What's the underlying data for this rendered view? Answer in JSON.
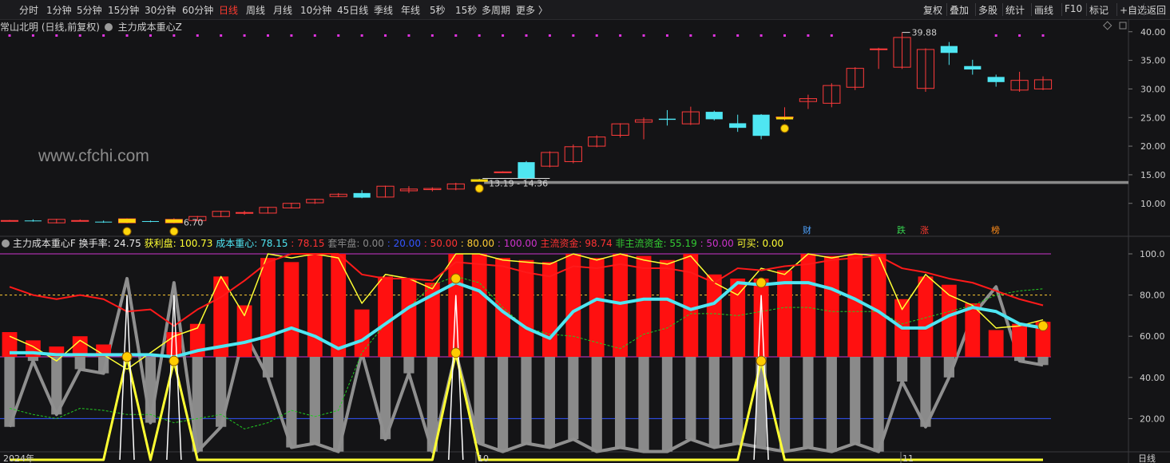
{
  "toolbar": {
    "timeframes": [
      "分时",
      "1分钟",
      "5分钟",
      "15分钟",
      "30分钟",
      "60分钟",
      "日线",
      "周线",
      "月线",
      "10分钟",
      "45日线",
      "季线",
      "年线",
      "5秒",
      "15秒",
      "多周期",
      "更多 〉"
    ],
    "active_timeframe": "日线",
    "right_buttons": [
      "复权",
      "叠加",
      "多股",
      "统计",
      "画线",
      "F10",
      "标记",
      "+自选",
      "返回"
    ]
  },
  "title": {
    "stock": "常山北明 (日线,前复权)",
    "indicator": "主力成本重心Z"
  },
  "price_axis": {
    "labels": [
      "40.00",
      "35.00",
      "30.00",
      "25.00",
      "20.00",
      "15.00",
      "10.00"
    ],
    "min": 5.5,
    "max": 41.5
  },
  "price_annotations": {
    "high": "39.88",
    "low": "6.70",
    "range": "13.19 - 14.36"
  },
  "watermark": "www.cfchi.com",
  "event_markers": [
    {
      "label": "财",
      "color": "#4fa3ff"
    },
    {
      "label": "跌",
      "color": "#36d24f"
    },
    {
      "label": "涨",
      "color": "#ff3b30"
    },
    {
      "label": "榜",
      "color": "#ff8c1a"
    }
  ],
  "indicator": {
    "name": "主力成本重心F",
    "items": [
      {
        "label": "换手率: ",
        "value": "24.75",
        "color": "#e6e6e6"
      },
      {
        "label": "获利盘: ",
        "value": "100.73",
        "color": "#ffff33"
      },
      {
        "label": "成本重心: ",
        "value": "78.15",
        "color": "#4fe6f2"
      },
      {
        "label": ": ",
        "value": "78.15",
        "color": "#ff3333"
      },
      {
        "label": "套牢盘: ",
        "value": "0.00",
        "color": "#888888"
      },
      {
        "label": ": ",
        "value": "20.00",
        "color": "#3355ff"
      },
      {
        "label": ": ",
        "value": "50.00",
        "color": "#ff3333"
      },
      {
        "label": ": ",
        "value": "80.00",
        "color": "#ffcc33"
      },
      {
        "label": ": ",
        "value": "100.00",
        "color": "#cc33cc"
      },
      {
        "label": "主流资金: ",
        "value": "98.74",
        "color": "#ff3333"
      },
      {
        "label": "非主流资金: ",
        "value": "55.19",
        "color": "#33cc33"
      },
      {
        "label": ": ",
        "value": "50.00",
        "color": "#cc33cc"
      },
      {
        "label": "可买: ",
        "value": "0.00",
        "color": "#ffff33"
      }
    ],
    "axis_labels": [
      "100.0",
      "80.00",
      "60.00",
      "40.00",
      "20.00"
    ],
    "min": 0,
    "max": 100
  },
  "date_axis": {
    "labels": [
      "2024年",
      "10",
      "11"
    ],
    "period": "日线"
  },
  "chart_data": {
    "type": "candlestick",
    "candles": [
      [
        6.9,
        7.0,
        6.8,
        7.1
      ],
      [
        7.0,
        6.9,
        6.8,
        7.2
      ],
      [
        6.6,
        7.2,
        6.5,
        7.3
      ],
      [
        7.0,
        7.0,
        6.9,
        7.2
      ],
      [
        6.8,
        6.7,
        6.6,
        7.0
      ],
      [
        6.6,
        7.3,
        6.5,
        7.4
      ],
      [
        6.9,
        6.8,
        6.7,
        7.0
      ],
      [
        6.6,
        7.2,
        6.5,
        7.4
      ],
      [
        7.0,
        7.7,
        6.9,
        7.8
      ],
      [
        7.7,
        8.6,
        7.6,
        8.7
      ],
      [
        8.3,
        8.4,
        8.0,
        8.7
      ],
      [
        8.3,
        9.3,
        8.2,
        9.4
      ],
      [
        9.2,
        10.0,
        9.1,
        10.1
      ],
      [
        10.1,
        10.7,
        9.9,
        10.8
      ],
      [
        11.2,
        11.6,
        11.1,
        11.8
      ],
      [
        11.8,
        11.0,
        10.9,
        12.3
      ],
      [
        11.1,
        13.0,
        11.0,
        13.1
      ],
      [
        12.2,
        12.5,
        11.8,
        13.0
      ],
      [
        12.4,
        12.6,
        12.1,
        12.8
      ],
      [
        12.5,
        13.4,
        12.3,
        13.6
      ],
      [
        14.2,
        14.1,
        14.0,
        14.3
      ],
      [
        15.5,
        15.5,
        15.4,
        15.6
      ],
      [
        17.2,
        14.4,
        14.2,
        17.4
      ],
      [
        16.5,
        18.9,
        16.3,
        19.1
      ],
      [
        17.3,
        19.9,
        17.0,
        20.3
      ],
      [
        20.0,
        21.6,
        19.8,
        21.9
      ],
      [
        21.9,
        23.9,
        21.5,
        24.0
      ],
      [
        24.2,
        24.6,
        21.2,
        25.0
      ],
      [
        24.8,
        24.6,
        23.6,
        26.3
      ],
      [
        23.9,
        26.0,
        23.7,
        26.9
      ],
      [
        26.0,
        24.7,
        24.5,
        26.2
      ],
      [
        24.0,
        23.2,
        22.5,
        25.5
      ],
      [
        25.5,
        21.8,
        21.2,
        25.6
      ],
      [
        25.0,
        25.1,
        24.5,
        26.8
      ],
      [
        27.8,
        28.3,
        26.5,
        29.0
      ],
      [
        27.5,
        30.6,
        26.8,
        31.0
      ],
      [
        30.3,
        33.6,
        29.8,
        33.8
      ],
      [
        37.0,
        37.0,
        33.5,
        37.2
      ],
      [
        33.8,
        39.0,
        33.5,
        39.88
      ],
      [
        30.1,
        36.9,
        29.5,
        37.1
      ],
      [
        37.5,
        36.3,
        34.2,
        38.2
      ],
      [
        34.0,
        33.4,
        32.5,
        35.1
      ],
      [
        32.1,
        31.2,
        30.4,
        32.5
      ],
      [
        29.8,
        31.5,
        29.5,
        33.0
      ],
      [
        30.0,
        31.6,
        29.8,
        32.2
      ]
    ],
    "indicator_series": {
      "turnover": [
        62,
        58,
        55,
        60,
        56,
        51,
        49,
        62,
        66,
        89,
        75,
        98,
        96,
        100,
        100,
        73,
        89,
        88,
        86,
        100,
        100,
        98,
        97,
        96,
        100,
        98,
        100,
        99,
        97,
        100,
        90,
        88,
        88,
        92,
        100,
        99,
        100,
        100,
        78,
        89,
        85,
        76,
        63,
        66,
        67
      ],
      "profit_ratio": [
        60,
        55,
        48,
        58,
        51,
        44,
        52,
        60,
        64,
        89,
        70,
        100,
        98,
        100,
        98,
        76,
        90,
        88,
        83,
        100,
        100,
        97,
        96,
        95,
        100,
        97,
        100,
        97,
        95,
        99,
        86,
        80,
        93,
        90,
        100,
        98,
        100,
        99,
        73,
        90,
        80,
        75,
        64,
        65,
        68
      ],
      "cost_center": [
        52,
        52,
        51,
        51,
        51,
        51,
        51,
        50,
        53,
        55,
        57,
        60,
        64,
        60,
        54,
        58,
        66,
        74,
        80,
        86,
        82,
        72,
        64,
        59,
        72,
        78,
        76,
        78,
        78,
        73,
        76,
        86,
        85,
        86,
        86,
        83,
        78,
        72,
        64,
        64,
        70,
        74,
        72,
        66,
        64
      ],
      "main_force": [
        84,
        80,
        78,
        80,
        78,
        72,
        73,
        65,
        73,
        79,
        87,
        96,
        100,
        100,
        100,
        90,
        88,
        88,
        87,
        96,
        95,
        94,
        91,
        89,
        94,
        93,
        95,
        93,
        93,
        91,
        86,
        93,
        92,
        94,
        95,
        97,
        98,
        99,
        93,
        91,
        88,
        86,
        82,
        78,
        75
      ],
      "non_main": [
        25,
        22,
        20,
        25,
        24,
        22,
        22,
        18,
        20,
        22,
        15,
        18,
        24,
        21,
        24,
        52,
        66,
        74,
        85,
        89,
        86,
        74,
        64,
        61,
        60,
        57,
        54,
        61,
        64,
        71,
        71,
        70,
        72,
        74,
        74,
        72,
        72,
        72,
        66,
        69,
        72,
        75,
        80,
        82,
        83
      ],
      "trapped": [
        16,
        48,
        22,
        44,
        42,
        88,
        18,
        86,
        4,
        16,
        62,
        40,
        6,
        8,
        4,
        52,
        10,
        42,
        4,
        52,
        8,
        4,
        8,
        6,
        10,
        4,
        6,
        4,
        4,
        10,
        6,
        8,
        6,
        4,
        6,
        4,
        8,
        4,
        38,
        16,
        40,
        70,
        84,
        48,
        46
      ],
      "buy": [
        0,
        0,
        0,
        0,
        0,
        50,
        0,
        48,
        0,
        0,
        0,
        0,
        0,
        0,
        0,
        0,
        0,
        0,
        0,
        52,
        0,
        0,
        0,
        0,
        0,
        0,
        0,
        0,
        0,
        0,
        0,
        0,
        48,
        0,
        0,
        0,
        0,
        0,
        0,
        0,
        0,
        0,
        0,
        0,
        0
      ]
    }
  }
}
